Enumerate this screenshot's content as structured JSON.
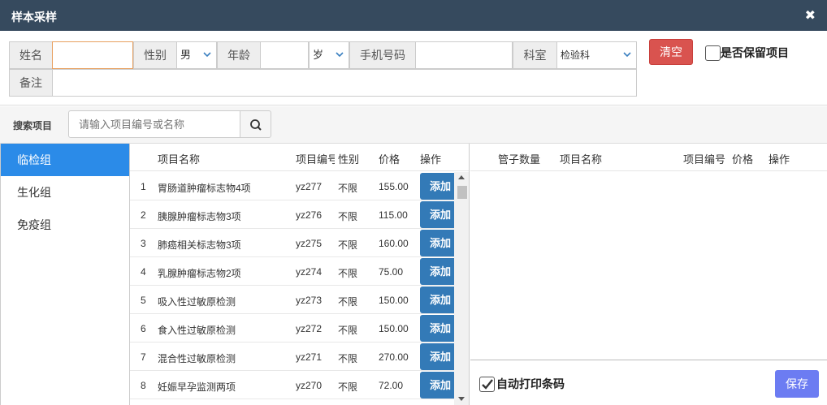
{
  "window": {
    "title": "样本采样",
    "close_symbol": "✖"
  },
  "form": {
    "name_label": "姓名",
    "name_value": "",
    "gender_label": "性别",
    "gender_value": "男",
    "age_label": "年龄",
    "age_value": "",
    "age_unit": "岁",
    "phone_label": "手机号码",
    "phone_value": "",
    "dept_label": "科室",
    "dept_value": "检验科",
    "remark_label": "备注",
    "remark_value": "",
    "clear_label": "清空",
    "keep_label": "是否保留项目"
  },
  "search": {
    "label": "搜索项目",
    "placeholder": "请输入项目编号或名称"
  },
  "groups": [
    {
      "label": "临检组",
      "active": true
    },
    {
      "label": "生化组"
    },
    {
      "label": "免疫组"
    }
  ],
  "items_table": {
    "headers": {
      "name": "项目名称",
      "code": "项目编号",
      "gender": "性别",
      "price": "价格",
      "action": "操作"
    },
    "add_label": "添加",
    "rows": [
      {
        "index": "1",
        "name": "胃肠道肿瘤标志物4项",
        "code": "yz277",
        "gender": "不限",
        "price": "155.00"
      },
      {
        "index": "2",
        "name": "胰腺肿瘤标志物3项",
        "code": "yz276",
        "gender": "不限",
        "price": "115.00"
      },
      {
        "index": "3",
        "name": "肺癌相关标志物3项",
        "code": "yz275",
        "gender": "不限",
        "price": "160.00"
      },
      {
        "index": "4",
        "name": "乳腺肿瘤标志物2项",
        "code": "yz274",
        "gender": "不限",
        "price": "75.00"
      },
      {
        "index": "5",
        "name": "吸入性过敏原检测",
        "code": "yz273",
        "gender": "不限",
        "price": "150.00"
      },
      {
        "index": "6",
        "name": "食入性过敏原检测",
        "code": "yz272",
        "gender": "不限",
        "price": "150.00"
      },
      {
        "index": "7",
        "name": "混合性过敏原检测",
        "code": "yz271",
        "gender": "不限",
        "price": "270.00"
      },
      {
        "index": "8",
        "name": "妊娠早孕监测两项",
        "code": "yz270",
        "gender": "不限",
        "price": "72.00"
      }
    ]
  },
  "selected_table": {
    "headers": {
      "tube_count": "管子数量",
      "name": "项目名称",
      "code": "项目编号",
      "price": "价格",
      "action": "操作"
    }
  },
  "footer": {
    "auto_print_label": "自动打印条码",
    "auto_print_checked": true,
    "save_label": "保存"
  },
  "colors": {
    "title_bar": "#364a5e",
    "active_group": "#2b8be8",
    "add_button": "#337ab7",
    "clear_button": "#d9534f",
    "save_button": "#6c7cf2"
  }
}
